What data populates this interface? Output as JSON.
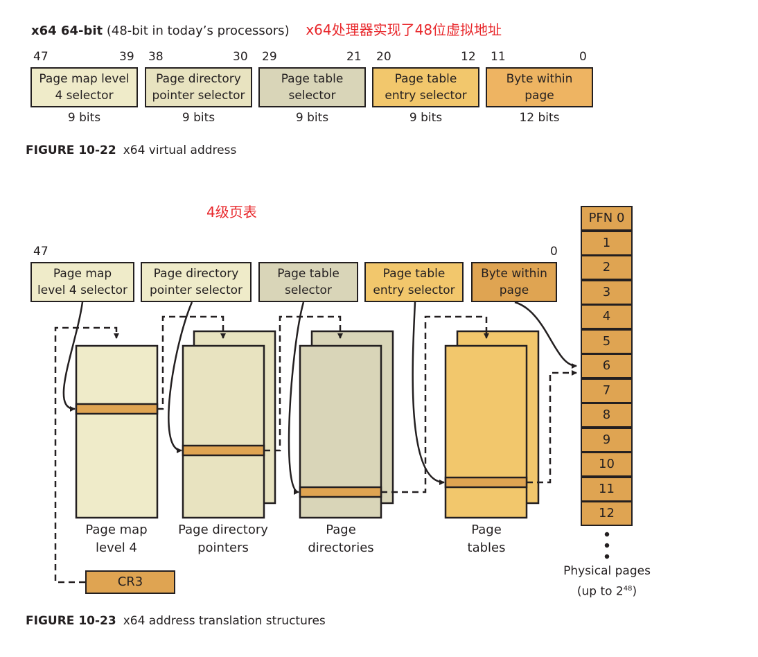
{
  "header": {
    "bold": "x64 64-bit",
    "normal": "(48-bit in today’s processors)",
    "annotation": "x64处理器实现了48位虚拟地址",
    "annotation_color": "#e8262a"
  },
  "fig22": {
    "fields": [
      {
        "hi": "47",
        "lo": "39",
        "label_1": "Page map level",
        "label_2": "4 selector",
        "bits": "9 bits",
        "color": "#efebc9"
      },
      {
        "hi": "38",
        "lo": "30",
        "label_1": "Page directory",
        "label_2": "pointer selector",
        "bits": "9 bits",
        "color": "#e8e3c0"
      },
      {
        "hi": "29",
        "lo": "21",
        "label_1": "Page table",
        "label_2": "selector",
        "bits": "9 bits",
        "color": "#d9d5b8"
      },
      {
        "hi": "20",
        "lo": "12",
        "label_1": "Page table",
        "label_2": "entry selector",
        "bits": "9 bits",
        "color": "#f2c76c"
      },
      {
        "hi": "11",
        "lo": "0",
        "label_1": "Byte within",
        "label_2": "page",
        "bits": "12 bits",
        "color": "#eeb462"
      }
    ],
    "caption_num": "FIGURE 10-22",
    "caption_text": "x64 virtual address"
  },
  "fig23": {
    "annotation": "4级页表",
    "bit_hi": "47",
    "bit_lo": "0",
    "selectors": [
      {
        "label_1": "Page map",
        "label_2": "level 4 selector",
        "color": "#efebc9"
      },
      {
        "label_1": "Page directory",
        "label_2": "pointer selector",
        "color": "#efebc9"
      },
      {
        "label_1": "Page table",
        "label_2": "selector",
        "color": "#d9d5b8"
      },
      {
        "label_1": "Page table",
        "label_2": "entry selector",
        "color": "#f2c76c"
      },
      {
        "label_1": "Byte within",
        "label_2": "page",
        "color": "#dfa452"
      }
    ],
    "tables": [
      {
        "label_1": "Page map",
        "label_2": "level 4",
        "color": "#efebc9"
      },
      {
        "label_1": "Page directory",
        "label_2": "pointers",
        "color": "#e8e3c0"
      },
      {
        "label_1": "Page",
        "label_2": "directories",
        "color": "#d9d5b8"
      },
      {
        "label_1": "Page",
        "label_2": "tables",
        "color": "#f2c76c"
      }
    ],
    "entry_color": "#dfa452",
    "cr3": "CR3",
    "pfns": [
      "PFN 0",
      "1",
      "2",
      "3",
      "4",
      "5",
      "6",
      "7",
      "8",
      "9",
      "10",
      "11",
      "12"
    ],
    "physical_label_1": "Physical pages",
    "physical_label_2": "(up to 2",
    "physical_exp": "48",
    "physical_close": ")",
    "caption_num": "FIGURE 10-23",
    "caption_text": "x64 address translation structures"
  }
}
